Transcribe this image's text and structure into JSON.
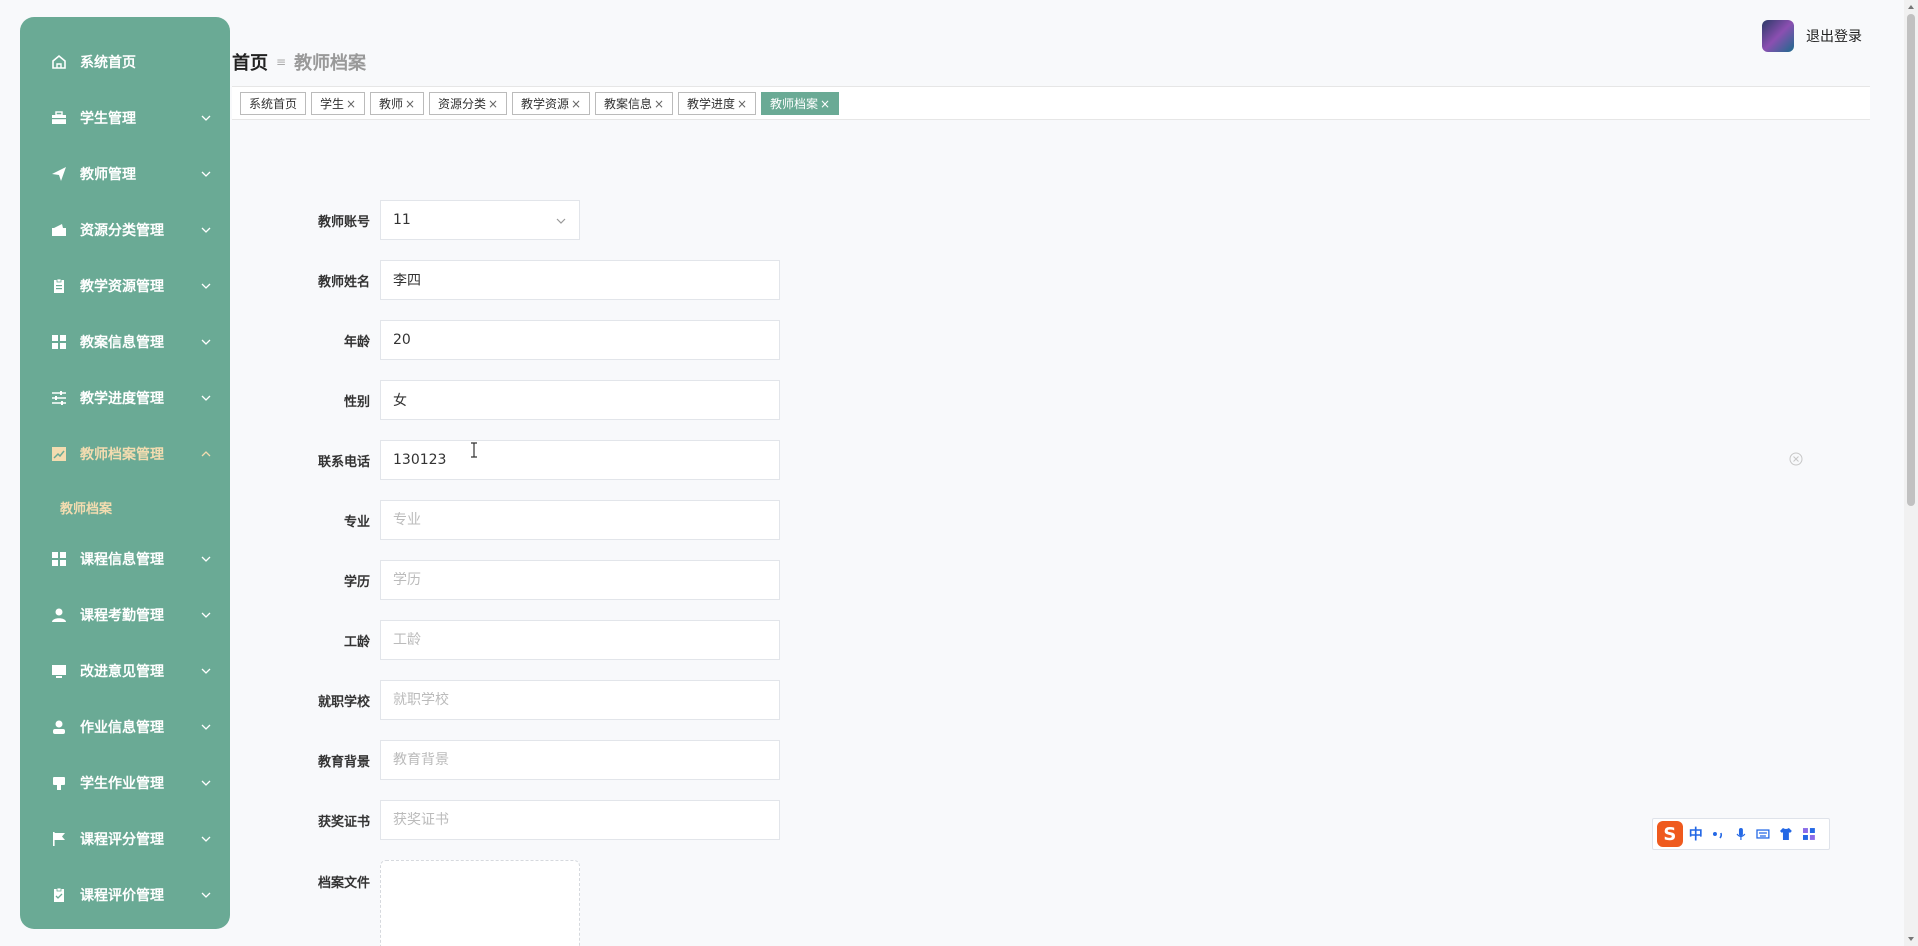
{
  "sidebar": {
    "items": [
      {
        "label": "系统首页",
        "icon": "home-icon",
        "arrow": false
      },
      {
        "label": "学生管理",
        "icon": "briefcase-icon",
        "arrow": true
      },
      {
        "label": "教师管理",
        "icon": "send-icon",
        "arrow": true
      },
      {
        "label": "资源分类管理",
        "icon": "wallet-icon",
        "arrow": true
      },
      {
        "label": "教学资源管理",
        "icon": "clipboard-icon",
        "arrow": true
      },
      {
        "label": "教案信息管理",
        "icon": "grid-icon",
        "arrow": true
      },
      {
        "label": "教学进度管理",
        "icon": "sliders-icon",
        "arrow": true
      },
      {
        "label": "教师档案管理",
        "icon": "chart-icon",
        "arrow": true,
        "expanded": true
      },
      {
        "label": "课程信息管理",
        "icon": "grid-icon",
        "arrow": true
      },
      {
        "label": "课程考勤管理",
        "icon": "user-icon",
        "arrow": true
      },
      {
        "label": "改进意见管理",
        "icon": "monitor-icon",
        "arrow": true
      },
      {
        "label": "作业信息管理",
        "icon": "person-icon",
        "arrow": true
      },
      {
        "label": "学生作业管理",
        "icon": "cup-icon",
        "arrow": true
      },
      {
        "label": "课程评分管理",
        "icon": "flag-icon",
        "arrow": true
      },
      {
        "label": "课程评价管理",
        "icon": "document-icon",
        "arrow": true
      }
    ],
    "submenu": {
      "label": "教师档案"
    }
  },
  "header": {
    "breadcrumb_home": "首页",
    "breadcrumb_current": "教师档案",
    "logout_label": "退出登录"
  },
  "tabs": [
    {
      "label": "系统首页",
      "closable": false
    },
    {
      "label": "学生",
      "closable": true
    },
    {
      "label": "教师",
      "closable": true
    },
    {
      "label": "资源分类",
      "closable": true
    },
    {
      "label": "教学资源",
      "closable": true
    },
    {
      "label": "教案信息",
      "closable": true
    },
    {
      "label": "教学进度",
      "closable": true
    },
    {
      "label": "教师档案",
      "closable": true,
      "active": true
    }
  ],
  "form": {
    "account_label": "教师账号",
    "account_value": "11",
    "name_label": "教师姓名",
    "name_value": "李四",
    "age_label": "年龄",
    "age_value": "20",
    "gender_label": "性别",
    "gender_value": "女",
    "phone_label": "联系电话",
    "phone_value": "130123",
    "major_label": "专业",
    "major_placeholder": "专业",
    "education_label": "学历",
    "education_placeholder": "学历",
    "seniority_label": "工龄",
    "seniority_placeholder": "工龄",
    "school_label": "就职学校",
    "school_placeholder": "就职学校",
    "background_label": "教育背景",
    "background_placeholder": "教育背景",
    "awards_label": "获奖证书",
    "awards_placeholder": "获奖证书",
    "file_label": "档案文件"
  },
  "ime": {
    "chinese_label": "中"
  },
  "colors": {
    "sidebar_bg": "#6aaa95",
    "sidebar_active": "#f3dcb0",
    "tab_active": "#6aaa95"
  }
}
